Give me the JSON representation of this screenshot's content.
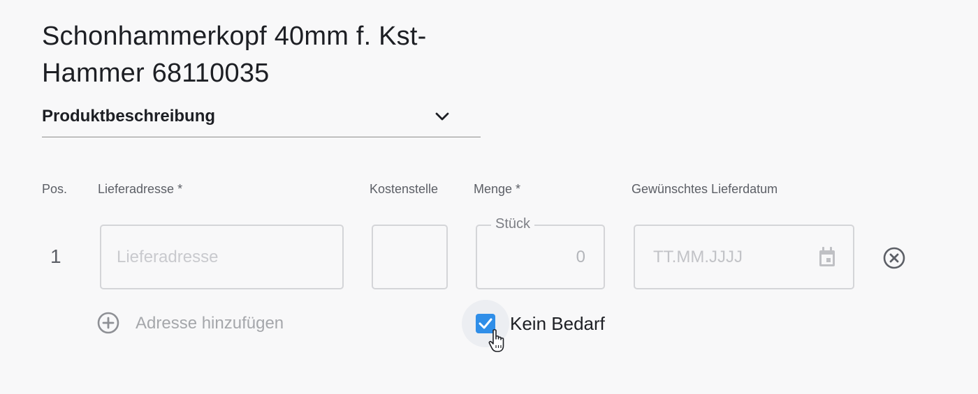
{
  "product": {
    "title": "Schonhammerkopf 40mm f. Kst-Hammer 68110035"
  },
  "accordion": {
    "label": "Produktbeschreibung",
    "icon": "chevron-down-icon"
  },
  "columns": {
    "pos": "Pos.",
    "address": "Lieferadresse *",
    "cost_center": "Kostenstelle",
    "quantity": "Menge *",
    "delivery_date": "Gewünschtes Lieferdatum"
  },
  "row": {
    "pos": "1",
    "address": {
      "value": "",
      "placeholder": "Lieferadresse"
    },
    "cost_center": {
      "value": ""
    },
    "quantity": {
      "unit": "Stück",
      "value": "",
      "placeholder": "0"
    },
    "delivery_date": {
      "value": "",
      "placeholder": "TT.MM.JJJJ",
      "icon": "calendar-icon"
    },
    "remove_icon": "close-circle-icon"
  },
  "add_address": {
    "label": "Adresse hinzufügen",
    "icon": "plus-circle-icon"
  },
  "no_demand": {
    "label": "Kein Bedarf",
    "checked": true
  },
  "colors": {
    "accent": "#2f8ee8",
    "text": "#1d1f24",
    "muted": "#5c5f66",
    "border": "#d4d5d8",
    "background": "#f8f8f9"
  }
}
